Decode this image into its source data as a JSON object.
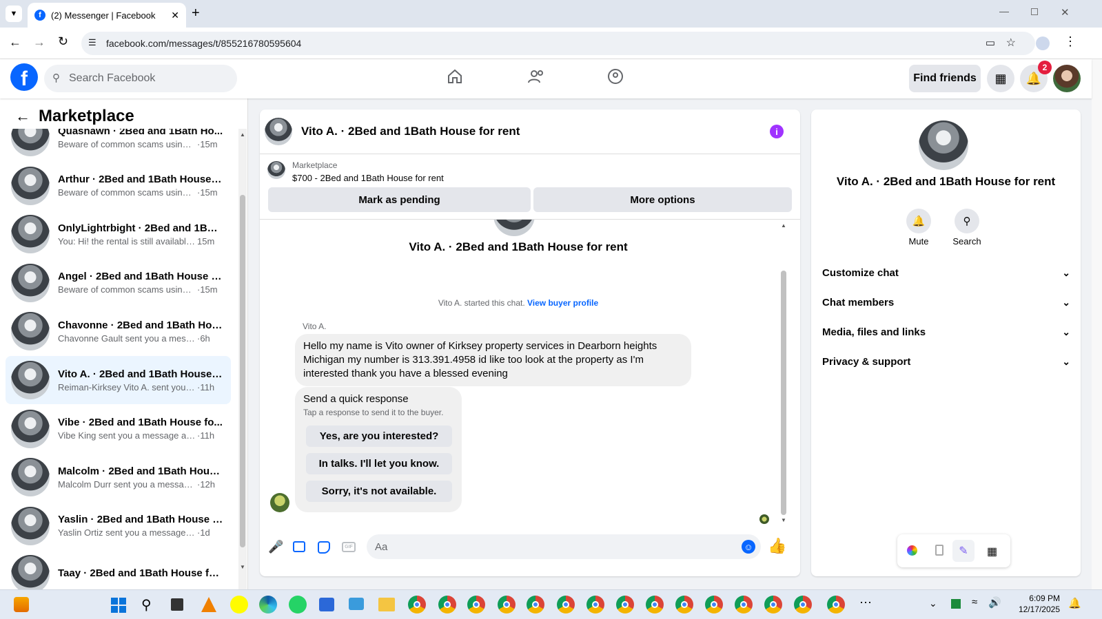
{
  "browser": {
    "tab_title": "(2) Messenger | Facebook",
    "url": "facebook.com/messages/t/855216780595604"
  },
  "fb": {
    "search_placeholder": "Search Facebook",
    "find_friends": "Find friends",
    "notification_count": "2"
  },
  "sidebar": {
    "title": "Marketplace",
    "items": [
      {
        "name": "Quashawn · 2Bed and 1Bath Ho...",
        "preview": "Beware of common scams using ...",
        "time": "·15m"
      },
      {
        "name": "Arthur · 2Bed and 1Bath House f...",
        "preview": "Beware of common scams using ...",
        "time": "·15m"
      },
      {
        "name": "OnlyLightrbight · 2Bed and 1Bat...",
        "preview": "You: Hi! the rental is still available...",
        "time": "15m"
      },
      {
        "name": "Angel · 2Bed and 1Bath House f...",
        "preview": "Beware of common scams using ...",
        "time": "·15m"
      },
      {
        "name": "Chavonne · 2Bed and 1Bath Hou...",
        "preview": "Chavonne Gault sent you a messag...",
        "time": "·6h"
      },
      {
        "name": "Vito A. · 2Bed and 1Bath House ...",
        "preview": "Reiman-Kirksey Vito A. sent you a...",
        "time": "·11h"
      },
      {
        "name": "Vibe · 2Bed and 1Bath House fo...",
        "preview": "Vibe King sent you a message ab...",
        "time": "·11h"
      },
      {
        "name": "Malcolm · 2Bed and 1Bath Hous...",
        "preview": "Malcolm Durr sent you a message...",
        "time": "·12h"
      },
      {
        "name": "Yaslin · 2Bed and 1Bath House f...",
        "preview": "Yaslin Ortiz sent you a message ab...",
        "time": "·1d"
      },
      {
        "name": "Taay · 2Bed and 1Bath House for...",
        "preview": "",
        "time": ""
      }
    ]
  },
  "chat": {
    "header_title": "Vito A. · 2Bed and 1Bath House for rent",
    "listing_label": "Marketplace",
    "listing_price": "$700 - 2Bed and 1Bath House for rent",
    "mark_pending": "Mark as pending",
    "more_options": "More options",
    "intro_name": "Vito A. · 2Bed and 1Bath House for rent",
    "started_text": "Vito A. started this chat.",
    "view_profile": "View buyer profile",
    "sender": "Vito A.",
    "message": "Hello my name is Vito owner of Kirksey property services in Dearborn heights Michigan my number is 313.391.4958 id like too look at the property as I'm interested thank you have a blessed evening",
    "quick_title": "Send a quick response",
    "quick_sub": "Tap a response to send it to the buyer.",
    "quick_replies": [
      "Yes, are you interested?",
      "In talks. I'll let you know.",
      "Sorry, it's not available."
    ],
    "input_placeholder": "Aa"
  },
  "info": {
    "name": "Vito A. · 2Bed and 1Bath House for rent",
    "mute": "Mute",
    "search": "Search",
    "sections": [
      "Customize chat",
      "Chat members",
      "Media, files and links",
      "Privacy & support"
    ]
  },
  "taskbar": {
    "time": "6:09 PM",
    "date": "12/17/2025"
  },
  "colors": {
    "accent": "#0866ff",
    "info_icon": "#a033ff",
    "selected": "#ebf5ff"
  }
}
